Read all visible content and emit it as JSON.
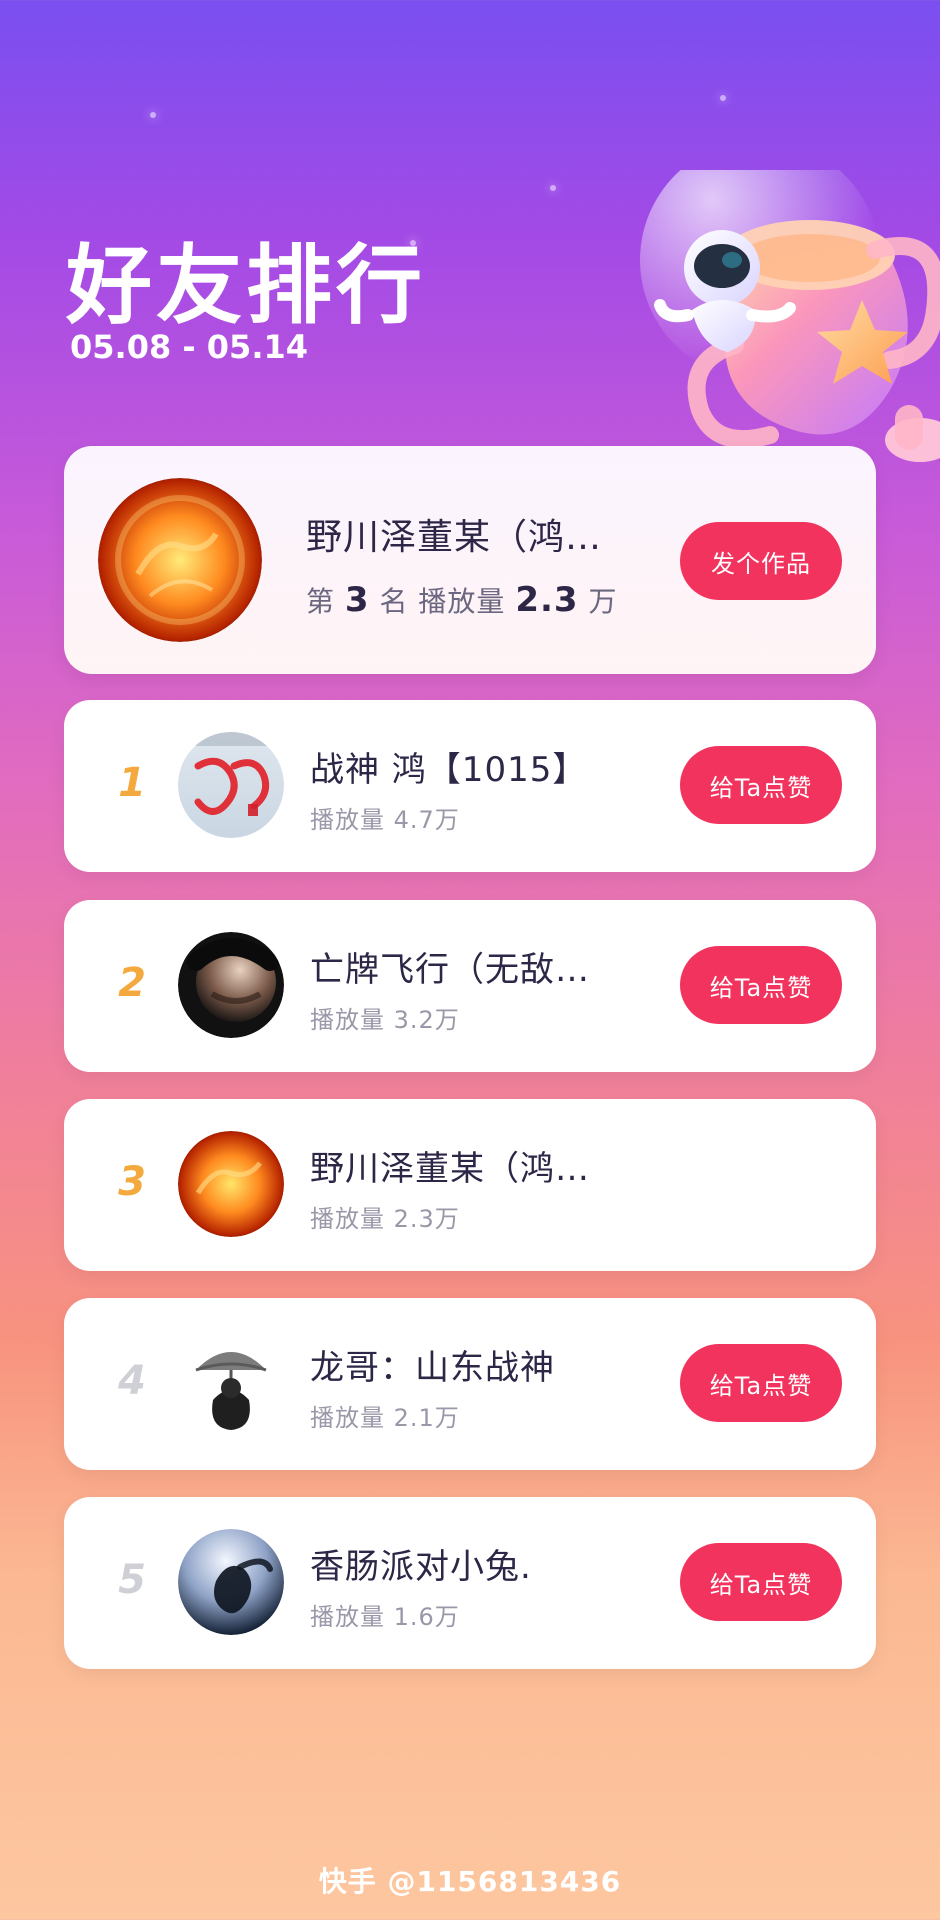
{
  "header": {
    "title": "好友排行",
    "date_range": "05.08 - 05.14"
  },
  "my_rank": {
    "name": "野川泽董某（鸿…",
    "rank_label_prefix": "第",
    "rank": "3",
    "rank_label_suffix": "名",
    "plays_label": "播放量",
    "plays_value": "2.3",
    "plays_unit": "万",
    "button_label": "发个作品"
  },
  "leaderboard": [
    {
      "rank": "1",
      "name": "战神 鸿【1015】",
      "plays": "播放量 4.7万",
      "button_label": "给Ta点赞"
    },
    {
      "rank": "2",
      "name": "亡牌飞行（无敌…",
      "plays": "播放量 3.2万",
      "button_label": "给Ta点赞"
    },
    {
      "rank": "3",
      "name": "野川泽董某（鸿…",
      "plays": "播放量 2.3万",
      "button_label": ""
    },
    {
      "rank": "4",
      "name": "龙哥：山东战神",
      "plays": "播放量 2.1万",
      "button_label": "给Ta点赞"
    },
    {
      "rank": "5",
      "name": "香肠派对小兔.",
      "plays": "播放量 1.6万",
      "button_label": "给Ta点赞"
    }
  ],
  "footer": {
    "watermark": "快手 @1156813436"
  },
  "colors": {
    "accent": "#f1335e",
    "gold_rank": "#f3a93d",
    "gray_rank": "#cfcfd6"
  },
  "icons": {
    "trophy": "trophy-icon",
    "astronaut": "astronaut-icon"
  }
}
